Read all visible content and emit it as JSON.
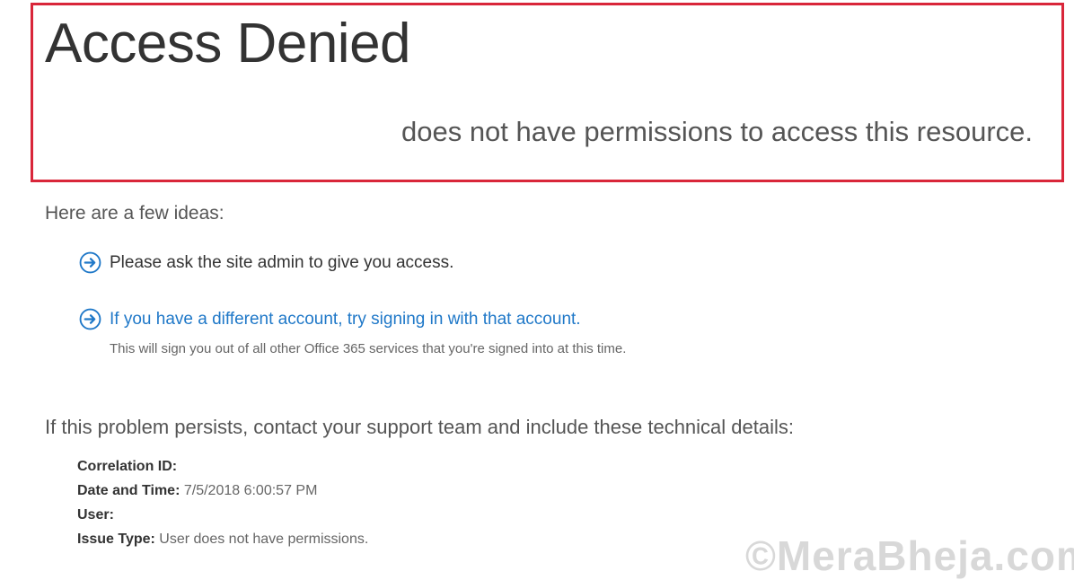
{
  "header": {
    "title": "Access Denied",
    "message": "does not have permissions to access this resource."
  },
  "ideas": {
    "heading": "Here are a few ideas:",
    "items": [
      {
        "text": "Please ask the site admin to give you access.",
        "icon": "arrow-circle-right-icon"
      },
      {
        "text": "If you have a different account, try signing in with that account.",
        "icon": "arrow-circle-right-icon",
        "subtext": "This will sign you out of all other Office 365 services that you're signed into at this time."
      }
    ]
  },
  "support": {
    "text": "If this problem persists, contact your support team and include these technical details:"
  },
  "details": {
    "correlation_label": "Correlation ID:",
    "correlation_value": "",
    "datetime_label": "Date and Time:",
    "datetime_value": "7/5/2018 6:00:57 PM",
    "user_label": "User:",
    "user_value": "",
    "issue_label": "Issue Type:",
    "issue_value": "User does not have permissions."
  },
  "watermark": "©MeraBheja.com",
  "colors": {
    "highlight_border": "#d9263a",
    "link": "#1f78c8"
  }
}
